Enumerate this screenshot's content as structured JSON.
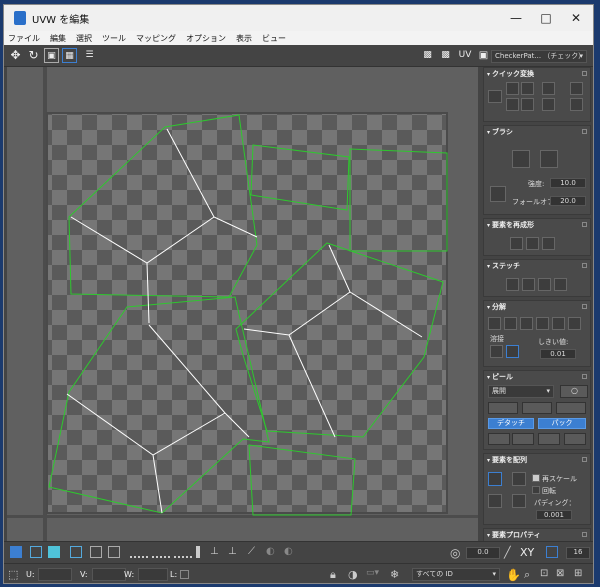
{
  "window": {
    "title": "UVW を編集"
  },
  "menu": [
    "ファイル",
    "編集",
    "選択",
    "ツール",
    "マッピング",
    "オプション",
    "表示",
    "ビュー"
  ],
  "toolbar": {
    "uv_label": "UV",
    "texture_dropdown": "CheckerPat... （チェック）"
  },
  "panel": {
    "quick_transform": "クイック変換",
    "brush": "ブラシ",
    "strength_label": "強度:",
    "strength_value": "10.0",
    "falloff_label": "フォールオフ:",
    "falloff_value": "20.0",
    "reshape": "要素を再成形",
    "stitch": "ステッチ",
    "explode": "分解",
    "weld_label": "溶接",
    "threshold_label": "しきい値:",
    "threshold_value": "0.01",
    "peel": "ピール",
    "peel_mode": "展開",
    "detach_button": "デタッチ",
    "pack_button": "パック",
    "arrange": "要素を配列",
    "rescale_label": "再スケール",
    "rotate_label": "回転",
    "padding_label": "パディング：",
    "padding_value": "0.001",
    "properties": "要素プロパティ"
  },
  "bottom": {
    "angle_value": "0.0",
    "xy_label": "XY",
    "grid_value": "16"
  },
  "status": {
    "u_label": "U:",
    "v_label": "V:",
    "w_label": "W:",
    "l_label": "L:",
    "id_dropdown": "すべての ID"
  },
  "colors": {
    "accent": "#3c7fd1",
    "uv_edge": "#2ec82e",
    "seam": "#ffffff"
  }
}
